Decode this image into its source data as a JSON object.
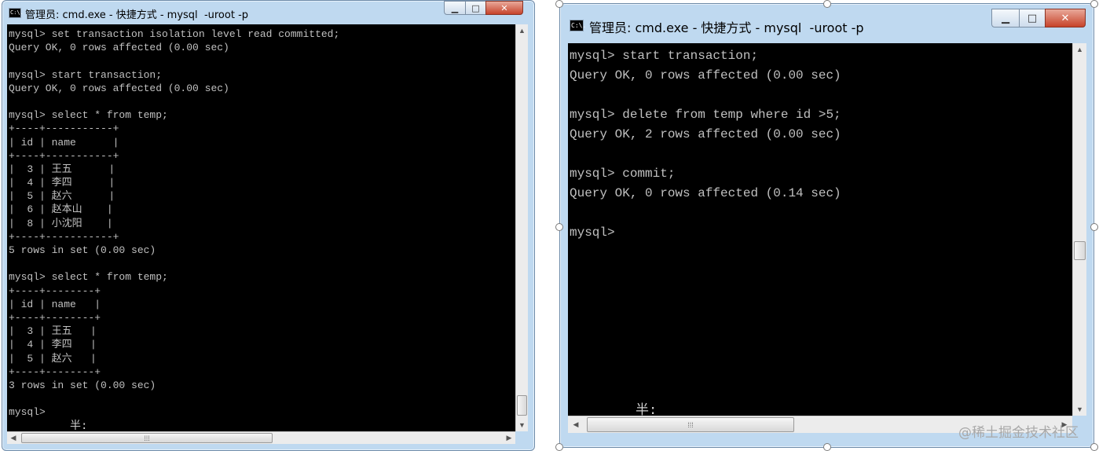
{
  "windows": {
    "left": {
      "title": "管理员: cmd.exe - 快捷方式 - mysql  -uroot -p",
      "icon_label": "C:\\.",
      "lines": [
        "mysql> set transaction isolation level read committed;",
        "Query OK, 0 rows affected (0.00 sec)",
        "",
        "mysql> start transaction;",
        "Query OK, 0 rows affected (0.00 sec)",
        "",
        "mysql> select * from temp;",
        "+----+-----------+",
        "| id | name      |",
        "+----+-----------+",
        "|  3 | 王五      |",
        "|  4 | 李四      |",
        "|  5 | 赵六      |",
        "|  6 | 赵本山    |",
        "|  8 | 小沈阳    |",
        "+----+-----------+",
        "5 rows in set (0.00 sec)",
        "",
        "mysql> select * from temp;",
        "+----+--------+",
        "| id | name   |",
        "+----+--------+",
        "|  3 | 王五   |",
        "|  4 | 李四   |",
        "|  5 | 赵六   |",
        "+----+--------+",
        "3 rows in set (0.00 sec)",
        "",
        "mysql>"
      ],
      "ime_text": "半:"
    },
    "right": {
      "title": "管理员: cmd.exe - 快捷方式 - mysql  -uroot -p",
      "icon_label": "C:\\.",
      "lines": [
        "mysql> start transaction;",
        "Query OK, 0 rows affected (0.00 sec)",
        "",
        "mysql> delete from temp where id >5;",
        "Query OK, 2 rows affected (0.00 sec)",
        "",
        "mysql> commit;",
        "Query OK, 0 rows affected (0.14 sec)",
        "",
        "mysql>"
      ],
      "ime_text": "半:"
    }
  },
  "controls": {
    "minimize_icon": "minimize-icon",
    "maximize_icon": "maximize-icon",
    "close_icon": "close-icon",
    "minimize_glyph": "▁",
    "maximize_glyph": "□",
    "close_glyph": "✕"
  },
  "watermark": "@稀土掘金技术社区"
}
